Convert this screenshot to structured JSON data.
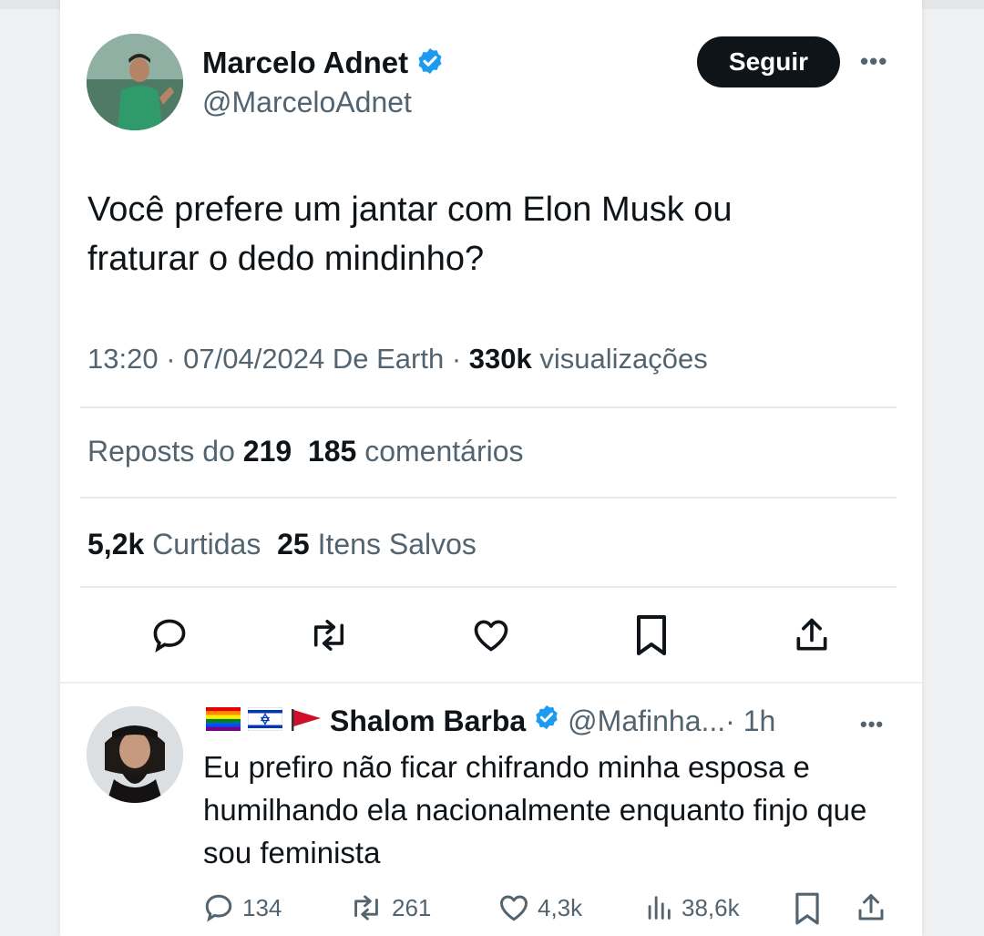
{
  "tweet": {
    "author_name": "Marcelo Adnet",
    "author_handle": "@MarceloAdnet",
    "follow_label": "Seguir",
    "more_label": "•••",
    "text": "Você prefere um jantar com Elon Musk ou fraturar o dedo mindinho?",
    "time": "13:20 · 07/04/2024 De Earth · ",
    "views_count": "330k",
    "views_label": " visualizações",
    "reposts_label": "Reposts do ",
    "reposts_count": "219",
    "comments_count": "185",
    "comments_label": " comentários",
    "likes_count": "5,2k",
    "likes_label": " Curtidas",
    "saves_count": "25",
    "saves_label": " Itens Salvos"
  },
  "reply": {
    "author_name": "Shalom Barba",
    "author_handle": "@Mafinha...",
    "time": " · 1h",
    "more_label": "•••",
    "text": "Eu prefiro não ficar chifrando minha esposa e humilhando ela nacionalmente enquanto finjo que sou feminista",
    "comments": "134",
    "reposts": "261",
    "likes": "4,3k",
    "views": "38,6k"
  },
  "colors": {
    "verified": "#1d9bf0",
    "text": "#0f1419",
    "muted": "#536471",
    "button": "#0f1419"
  }
}
